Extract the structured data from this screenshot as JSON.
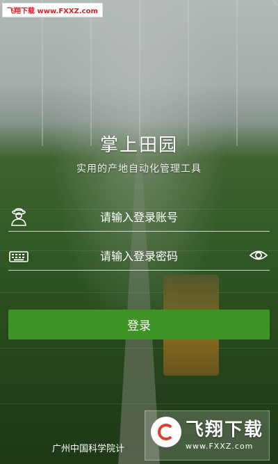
{
  "watermark_top": {
    "text": "飞翔下载 www.FXXZ.com"
  },
  "app": {
    "title": "掌上田园",
    "subtitle": "实用的产地自动化管理工具"
  },
  "login": {
    "account": {
      "placeholder": "请输入登录账号",
      "icon": "user-icon"
    },
    "password": {
      "placeholder": "请输入登录密码",
      "icon": "keyboard-icon",
      "toggle_icon": "eye-icon"
    },
    "submit_label": "登录"
  },
  "footer": {
    "text": "广州中国科学院计"
  },
  "watermark_br": {
    "brand": "飞翔下载",
    "url": "www.FXXZ.com"
  },
  "colors": {
    "button": "#3d9323",
    "text": "#ffffff",
    "watermark_red": "#d4222a"
  }
}
